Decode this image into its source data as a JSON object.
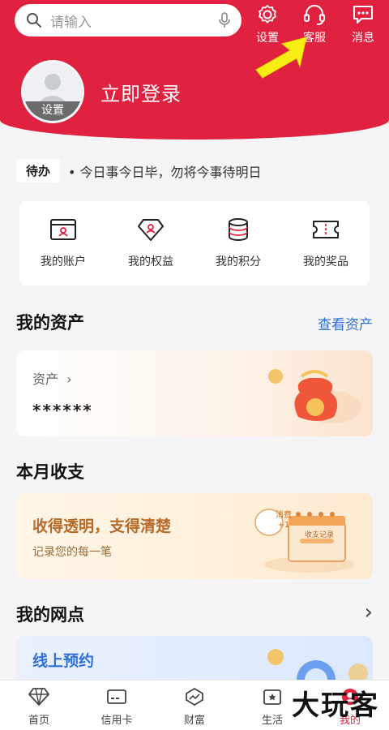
{
  "header": {
    "search_placeholder": "请输入",
    "settings_label": "设置",
    "service_label": "客服",
    "message_label": "消息",
    "avatar_label": "设置",
    "login_text": "立即登录"
  },
  "todo": {
    "tag": "待办",
    "text": "• 今日事今日毕，勿将今事待明日"
  },
  "quick_actions": [
    {
      "label": "我的账户",
      "icon": "account-icon"
    },
    {
      "label": "我的权益",
      "icon": "rights-icon"
    },
    {
      "label": "我的积分",
      "icon": "points-icon"
    },
    {
      "label": "我的奖品",
      "icon": "prize-icon"
    }
  ],
  "assets": {
    "title": "我的资产",
    "link": "查看资产",
    "label": "资产",
    "value": "******"
  },
  "monthly": {
    "title": "本月收支",
    "headline": "收得透明，支得清楚",
    "sub": "记录您的每一笔",
    "badge": "消费\n+1",
    "book": "收支记录"
  },
  "network": {
    "title": "我的网点",
    "card": "线上预约"
  },
  "tabs": [
    {
      "label": "首页",
      "icon": "home-icon"
    },
    {
      "label": "信用卡",
      "icon": "credit-card-icon"
    },
    {
      "label": "财富",
      "icon": "wealth-icon"
    },
    {
      "label": "生活",
      "icon": "life-icon"
    },
    {
      "label": "我的",
      "icon": "me-icon"
    }
  ],
  "watermark": "大玩客",
  "colors": {
    "brand": "#e0213f",
    "link": "#2f6fd8"
  }
}
